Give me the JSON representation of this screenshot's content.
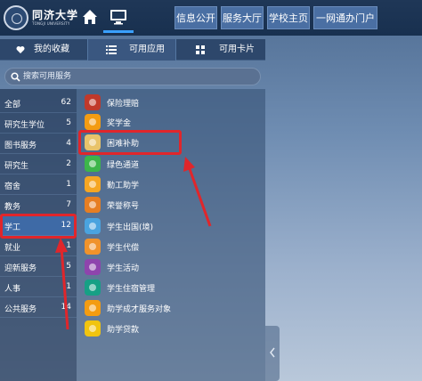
{
  "header": {
    "logo_text": "同济大学",
    "logo_subtitle": "TONGJI UNIVERSITY",
    "nav": [
      {
        "label": "信息公开"
      },
      {
        "label": "服务大厅"
      },
      {
        "label": "学校主页"
      },
      {
        "label": "一网通办门户"
      }
    ]
  },
  "tabs": [
    {
      "label": "我的收藏",
      "icon": "heart-icon"
    },
    {
      "label": "可用应用",
      "icon": "list-icon"
    },
    {
      "label": "可用卡片",
      "icon": "grid-icon"
    }
  ],
  "search": {
    "placeholder": "搜索可用服务"
  },
  "categories": [
    {
      "name": "全部",
      "count": "62"
    },
    {
      "name": "研究生学位",
      "count": "5"
    },
    {
      "name": "图书服务",
      "count": "4"
    },
    {
      "name": "研究生",
      "count": "2"
    },
    {
      "name": "宿舍",
      "count": "1"
    },
    {
      "name": "教务",
      "count": "7"
    },
    {
      "name": "学工",
      "count": "12"
    },
    {
      "name": "就业",
      "count": "1"
    },
    {
      "name": "迎新服务",
      "count": "5"
    },
    {
      "name": "人事",
      "count": "1"
    },
    {
      "name": "公共服务",
      "count": "14"
    }
  ],
  "services": [
    {
      "label": "保险理赔",
      "icon": "insurance-icon",
      "color": "#c0392b"
    },
    {
      "label": "奖学金",
      "icon": "scholarship-icon",
      "color": "#f39c12"
    },
    {
      "label": "困难补助",
      "icon": "subsidy-icon",
      "color": "#e8c36a"
    },
    {
      "label": "绿色通道",
      "icon": "green-channel-icon",
      "color": "#3cb54a"
    },
    {
      "label": "勤工助学",
      "icon": "work-study-icon",
      "color": "#f5a623"
    },
    {
      "label": "荣誉称号",
      "icon": "honor-icon",
      "color": "#e67e22"
    },
    {
      "label": "学生出国(境)",
      "icon": "abroad-icon",
      "color": "#4aa3df"
    },
    {
      "label": "学生代偿",
      "icon": "compensation-icon",
      "color": "#f0932b"
    },
    {
      "label": "学生活动",
      "icon": "activity-icon",
      "color": "#8e44ad"
    },
    {
      "label": "学生住宿管理",
      "icon": "dorm-icon",
      "color": "#16a085"
    },
    {
      "label": "助学成才服务对象",
      "icon": "support-icon",
      "color": "#f39c12"
    },
    {
      "label": "助学贷款",
      "icon": "loan-icon",
      "color": "#f1c40f"
    }
  ],
  "colors": {
    "topbar": "#1f3757",
    "nav_button": "#4a6fa3",
    "active_category": "#3e6aa6",
    "highlight": "#e0262b"
  }
}
